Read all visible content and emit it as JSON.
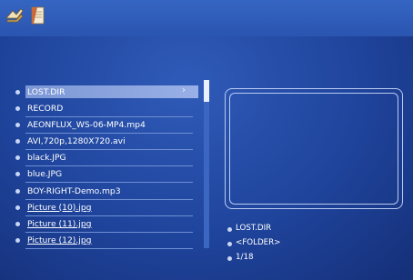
{
  "toolbar": {
    "icons": [
      "home-icon",
      "file-icon"
    ]
  },
  "file_list": [
    {
      "label": "LOST.DIR",
      "selected": true
    },
    {
      "label": "RECORD"
    },
    {
      "label": "AEONFLUX_WS-06-MP4.mp4"
    },
    {
      "label": "AVI,720p,1280X720.avi"
    },
    {
      "label": "black.JPG"
    },
    {
      "label": "blue.JPG"
    },
    {
      "label": "BOY-RIGHT-Demo.mp3"
    },
    {
      "label": "Picture  (10).jpg"
    },
    {
      "label": "Picture  (11).jpg"
    },
    {
      "label": "Picture  (12).jpg"
    }
  ],
  "selected_chevron": "›",
  "info": {
    "name": "LOST.DIR",
    "type": "<FOLDER>",
    "position": "1/18"
  }
}
